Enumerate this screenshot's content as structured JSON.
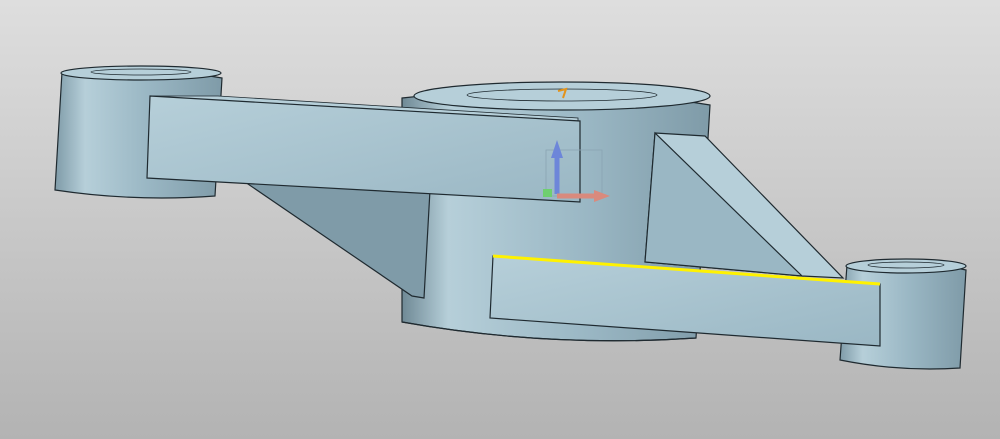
{
  "viewport": {
    "background_top": "#dedede",
    "background_bottom": "#b3b3b3"
  },
  "model": {
    "base_color": "#9ab7c4",
    "light_color": "#b6cfd9",
    "dark_color": "#7f9ba8",
    "shadow_color": "#6f8995",
    "edge_color": "#1f2a30",
    "selected_edge_color": "#fff200"
  },
  "triad": {
    "x_axis_color": "#d98a7d",
    "y_axis_color": "#6fcf6f",
    "z_axis_color": "#6d86d9",
    "origin_marker_color": "#e3931b"
  }
}
